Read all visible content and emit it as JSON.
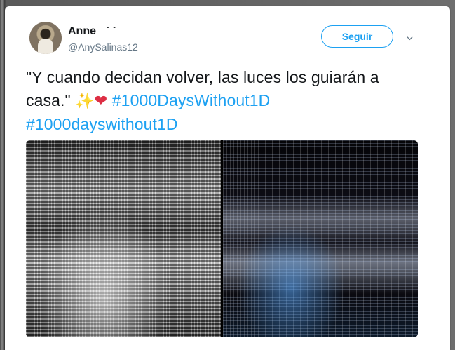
{
  "tweet": {
    "author_name": "Anne",
    "author_name_emoji": "˘ ˘",
    "handle": "@AnySalinas12",
    "follow_label": "Seguir",
    "text_part1": "\"Y cuando decidan volver, las luces los guiarán a casa.\" ",
    "emoji_sparkles": "✨",
    "emoji_heart": "❤",
    "hashtag1": "#1000DaysWithout1D",
    "hashtag2": "#1000dayswithout1D"
  },
  "colors": {
    "accent": "#1da1f2",
    "text": "#14171a",
    "secondary": "#657786"
  },
  "icons": [
    "avatar",
    "chevron-down-icon",
    "sparkles-icon",
    "heart-icon"
  ]
}
